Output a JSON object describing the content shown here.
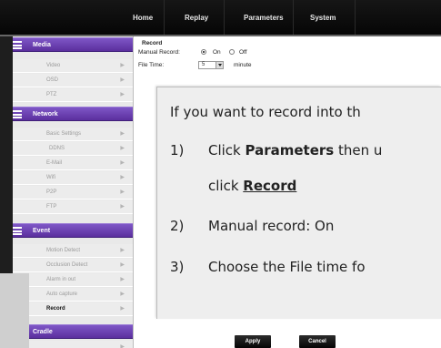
{
  "nav": {
    "items": [
      "Home",
      "Replay",
      "Parameters",
      "System"
    ]
  },
  "sidebar": {
    "sections": [
      {
        "title": "Media",
        "items": [
          "Video",
          "OSD",
          "PTZ"
        ]
      },
      {
        "title": "Network",
        "items": [
          "Basic Settings",
          "DDNS",
          "E-Mail",
          "Wifi",
          "P2P",
          "FTP"
        ]
      },
      {
        "title": "Event",
        "items": [
          "Motion Detect",
          "Occlusion Detect",
          "Alarm in out",
          "Auto capture",
          "Record"
        ]
      },
      {
        "title": "Cradle",
        "items": []
      }
    ],
    "active_item": "Record"
  },
  "form": {
    "title": "Record",
    "manual_record_label": "Manual Record:",
    "on_label": "On",
    "off_label": "Off",
    "manual_record_value": "On",
    "file_time_label": "File Time:",
    "file_time_value": "5",
    "file_time_unit": "minute"
  },
  "card": {
    "intro": "If you want to record into th",
    "steps": [
      {
        "num": "1)",
        "pre": "Click ",
        "bold": "Parameters",
        "post": " then u"
      },
      {
        "num": "",
        "pre": "click ",
        "link": "Record"
      },
      {
        "num": "2)",
        "text": "Manual record: On"
      },
      {
        "num": "3)",
        "text": "Choose the File time fo"
      }
    ]
  },
  "buttons": {
    "apply": "Apply",
    "cancel": "Cancel"
  },
  "colors": {
    "section_header": "#6a3fb3",
    "nav_bg": "#0f0f0f",
    "card_bg": "#eeeeee"
  }
}
